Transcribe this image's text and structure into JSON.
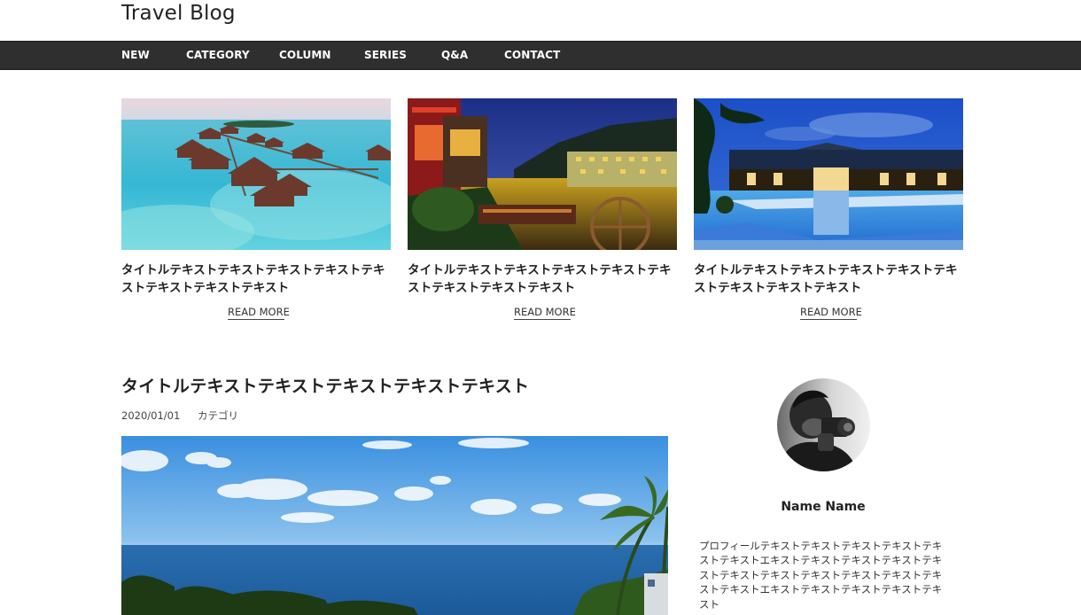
{
  "site": {
    "title": "Travel Blog"
  },
  "nav": {
    "items": [
      {
        "label": "NEW"
      },
      {
        "label": "CATEGORY"
      },
      {
        "label": "COLUMN"
      },
      {
        "label": "SERIES"
      },
      {
        "label": "Q&A"
      },
      {
        "label": "CONTACT"
      }
    ]
  },
  "featured": [
    {
      "title": "タイトルテキストテキストテキストテキストテキストテキストテキストテキスト",
      "more": "READ MORE",
      "image": "overwater-bungalows-photo"
    },
    {
      "title": "タイトルテキストテキストテキストテキストテキストテキストテキストテキスト",
      "more": "READ MORE",
      "image": "night-river-town-photo"
    },
    {
      "title": "タイトルテキストテキストテキストテキストテキストテキストテキストテキスト",
      "more": "READ MORE",
      "image": "resort-pool-night-photo"
    }
  ],
  "post": {
    "title": "タイトルテキストテキストテキストテキストテキスト",
    "date": "2020/01/01",
    "category": "カテゴリ",
    "image": "ocean-palm-trees-photo"
  },
  "profile": {
    "name": "Name Name",
    "bio": "プロフィールテキストテキストテキストテキストテキストテキストエキストテキストテキストテキストテキストテキストテキストテキストテキストテキストテキストテキストエキストテキストテキストテキストテキスト",
    "avatar": "photographer-avatar-photo"
  }
}
